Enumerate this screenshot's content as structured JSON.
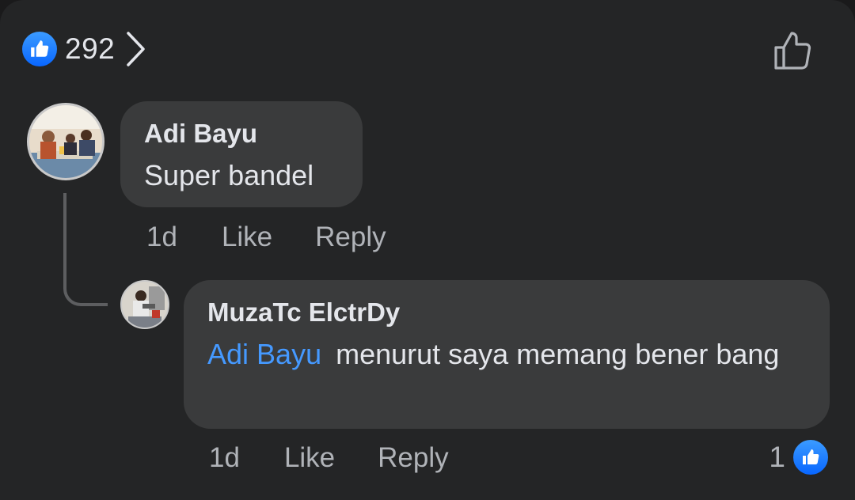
{
  "reactions": {
    "count": "292",
    "icon": "like-icon",
    "accent_color": "#0866ff"
  },
  "comments": [
    {
      "author": "Adi Bayu",
      "text": "Super bandel",
      "time": "1d",
      "like_label": "Like",
      "reply_label": "Reply",
      "avatar": "group-photo-avatar"
    }
  ],
  "replies": [
    {
      "author": "MuzaTc ElctrDy",
      "mention": "Adi Bayu",
      "text": "menurut saya memang bener bang",
      "time": "1d",
      "like_label": "Like",
      "reply_label": "Reply",
      "reaction_count": "1",
      "avatar": "person-photo-avatar"
    }
  ]
}
